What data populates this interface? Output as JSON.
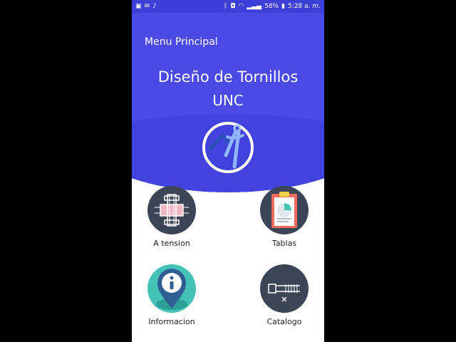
{
  "status_bar": {
    "left_icons": [
      "image-icon",
      "mail-icon",
      "music-note-icon"
    ],
    "right_icons": [
      "bluetooth-icon",
      "nfc-icon",
      "wifi-icon",
      "signal-icon"
    ],
    "battery": "58%",
    "time": "5:28 a. m."
  },
  "header": {
    "menu_title": "Menu Principal",
    "app_title": "Diseño de Tornillos",
    "app_subtitle": "UNC",
    "colors": {
      "primary": "#4a4ae6",
      "status": "#3d3fd9"
    }
  },
  "menu": {
    "items": [
      {
        "label": "A tension",
        "icon": "bolt-tension-icon"
      },
      {
        "label": "Tablas",
        "icon": "clipboard-icon"
      },
      {
        "label": "Informacion",
        "icon": "info-icon"
      },
      {
        "label": "Catalogo",
        "icon": "bolt-catalog-icon"
      }
    ]
  }
}
